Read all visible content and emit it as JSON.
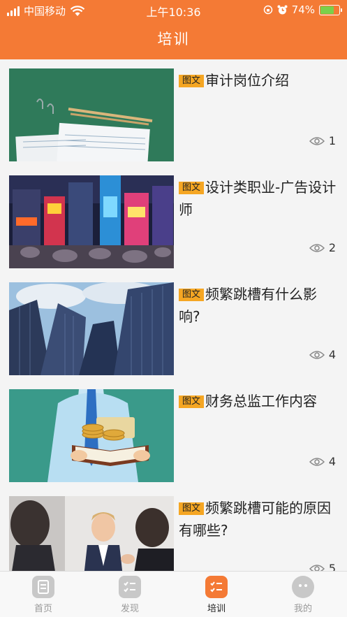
{
  "status_bar": {
    "carrier": "中国移动",
    "time": "上午10:36",
    "battery": "74%",
    "battery_level": 0.74
  },
  "header": {
    "title": "培训"
  },
  "articles": [
    {
      "tag": "图文",
      "title": "审计岗位介绍",
      "views": "1",
      "image": "tax-forms-desk"
    },
    {
      "tag": "图文",
      "title": "设计类职业-广告设计师",
      "views": "2",
      "image": "city-billboards-night"
    },
    {
      "tag": "图文",
      "title": "频繁跳槽有什么影响?",
      "views": "4",
      "image": "skyscrapers"
    },
    {
      "tag": "图文",
      "title": "财务总监工作内容",
      "views": "4",
      "image": "man-book-coins"
    },
    {
      "tag": "图文",
      "title": "频繁跳槽可能的原因有哪些?",
      "views": "5",
      "image": "business-meeting"
    }
  ],
  "tabbar": {
    "tabs": [
      {
        "label": "首页",
        "icon": "document-icon"
      },
      {
        "label": "发现",
        "icon": "checklist-icon"
      },
      {
        "label": "培训",
        "icon": "training-list-icon"
      },
      {
        "label": "我的",
        "icon": "profile-face-icon"
      }
    ],
    "active_index": 2
  },
  "colors": {
    "header": "#f47a35",
    "tag": "#f5a623",
    "active_tab": "#f47a35",
    "inactive_tab": "#c8c8c8"
  }
}
